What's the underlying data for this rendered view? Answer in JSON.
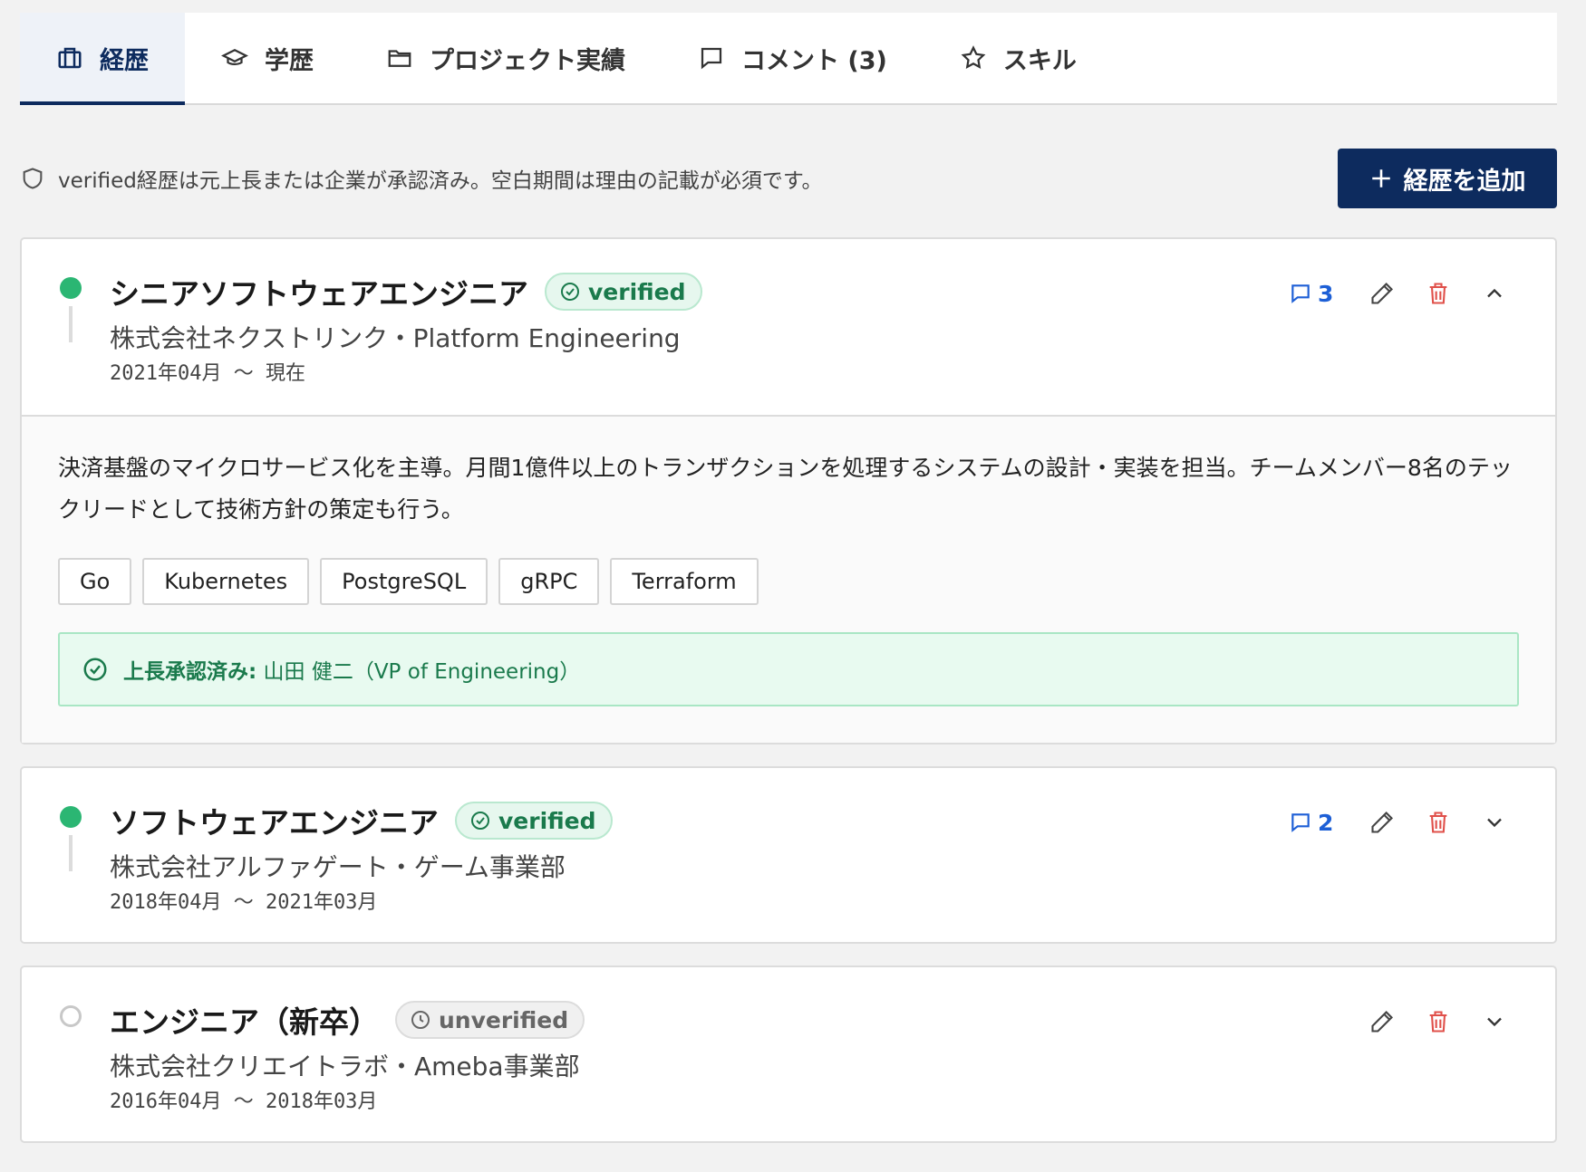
{
  "tabs": [
    {
      "label": "経歴",
      "icon": "briefcase-icon",
      "active": true
    },
    {
      "label": "学歴",
      "icon": "graduation-cap-icon",
      "active": false
    },
    {
      "label": "プロジェクト実績",
      "icon": "folder-icon",
      "active": false
    },
    {
      "label": "コメント (3)",
      "icon": "comment-icon",
      "active": false
    },
    {
      "label": "スキル",
      "icon": "star-icon",
      "active": false
    }
  ],
  "info": {
    "icon": "shield-icon",
    "text": "verified経歴は元上長または企業が承認済み。空白期間は理由の記載が必須です。"
  },
  "add_button": {
    "label": "経歴を追加",
    "icon": "plus-icon"
  },
  "colors": {
    "primary": "#0d2b5e",
    "verified": "#2bb673",
    "link": "#1d5fd6",
    "danger": "#e0504a"
  },
  "careers": [
    {
      "title": "シニアソフトウェアエンジニア",
      "status": "verified",
      "company": "株式会社ネクストリンク・Platform Engineering",
      "period": "2021年04月 〜 現在",
      "comments": "3",
      "expanded": true,
      "description": "決済基盤のマイクロサービス化を主導。月間1億件以上のトランザクションを処理するシステムの設計・実装を担当。チームメンバー8名のテックリードとして技術方針の策定も行う。",
      "tags": [
        "Go",
        "Kubernetes",
        "PostgreSQL",
        "gRPC",
        "Terraform"
      ],
      "approval_label": "上長承認済み:",
      "approval_value": "山田 健二（VP of Engineering）"
    },
    {
      "title": "ソフトウェアエンジニア",
      "status": "verified",
      "company": "株式会社アルファゲート・ゲーム事業部",
      "period": "2018年04月 〜 2021年03月",
      "comments": "2",
      "expanded": false
    },
    {
      "title": "エンジニア（新卒）",
      "status": "unverified",
      "company": "株式会社クリエイトラボ・Ameba事業部",
      "period": "2016年04月 〜 2018年03月",
      "expanded": false
    }
  ]
}
